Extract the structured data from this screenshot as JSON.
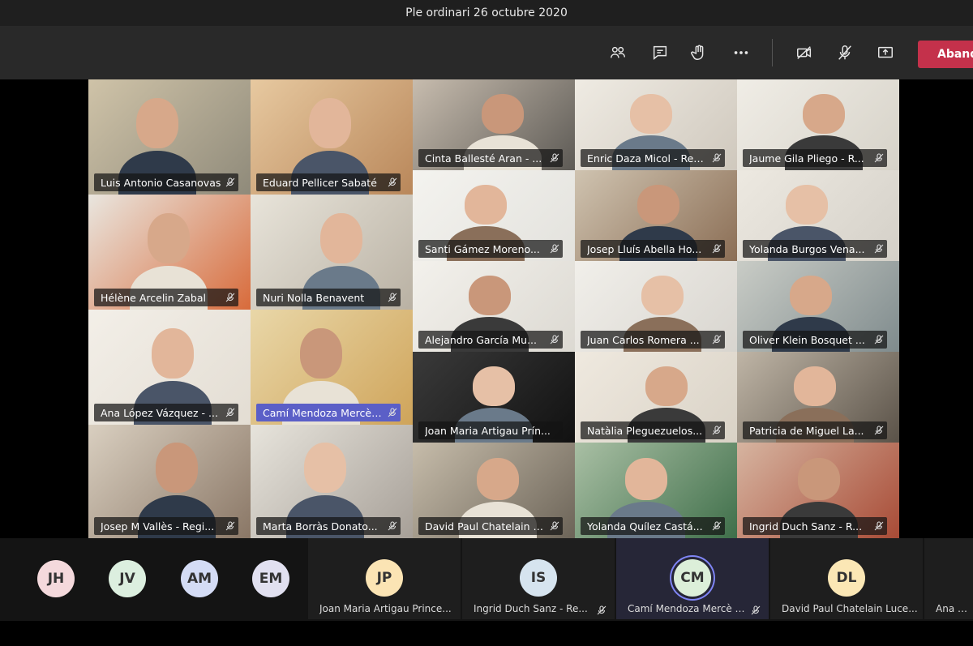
{
  "meeting": {
    "title": "Ple ordinari 26 octubre 2020"
  },
  "toolbar": {
    "leave_label": "Abandonar",
    "buttons": [
      "participants-icon",
      "chat-icon",
      "raise-hand-icon",
      "more-options-icon",
      "camera-off-icon",
      "mic-muted-icon",
      "share-screen-icon"
    ]
  },
  "grid": {
    "tiles": [
      {
        "name": "Luis Antonio Casanovas"
      },
      {
        "name": "Eduard Pellicer Sabaté"
      },
      {
        "name": "Cinta Ballesté Aran - ..."
      },
      {
        "name": "Enric Daza Micol - Regi..."
      },
      {
        "name": "Jaume Gila Pliego - R..."
      },
      {
        "name": "Santi Gámez Moreno..."
      },
      {
        "name": "Josep Lluís Abella Ho..."
      },
      {
        "name": "Yolanda Burgos Vena..."
      },
      {
        "name": "Hélène Arcelin Zabal"
      },
      {
        "name": "Nuri Nolla Benavent"
      },
      {
        "name": "Alejandro García Mu..."
      },
      {
        "name": "Juan Carlos Romera ..."
      },
      {
        "name": "Oliver Klein Bosquet ..."
      },
      {
        "name": "Ana López Vázquez - ..."
      },
      {
        "name": "Camí Mendoza Mercè - ..."
      },
      {
        "name": "Joan Maria Artigau Prín..."
      },
      {
        "name": "Natàlia Pleguezuelos..."
      },
      {
        "name": "Patricia de Miguel La..."
      },
      {
        "name": "Josep M Vallès - Regi..."
      },
      {
        "name": "Marta Borràs Donato..."
      },
      {
        "name": "David Paul Chatelain Lu..."
      },
      {
        "name": "Yolanda Quílez Castá..."
      },
      {
        "name": "Ingrid Duch Sanz - R..."
      }
    ]
  },
  "strip": {
    "avatars": [
      {
        "initials": "JH",
        "color": "#f4d9dc"
      },
      {
        "initials": "JV",
        "color": "#dcefdf"
      },
      {
        "initials": "AM",
        "color": "#d4dcf5"
      },
      {
        "initials": "EM",
        "color": "#e1e0f0"
      }
    ],
    "participants": [
      {
        "initials": "JP",
        "color": "#fbe4b4",
        "name": "Joan Maria Artigau Prince..."
      },
      {
        "initials": "IS",
        "color": "#d6e4ef",
        "name": "Ingrid Duch Sanz - Re..."
      },
      {
        "initials": "CM",
        "color": "#dcefd9",
        "name": "Camí Mendoza Mercè - Al..."
      },
      {
        "initials": "DL",
        "color": "#fbe7b5",
        "name": "David Paul Chatelain Luce..."
      },
      {
        "name": "Ana Lóp"
      }
    ]
  }
}
